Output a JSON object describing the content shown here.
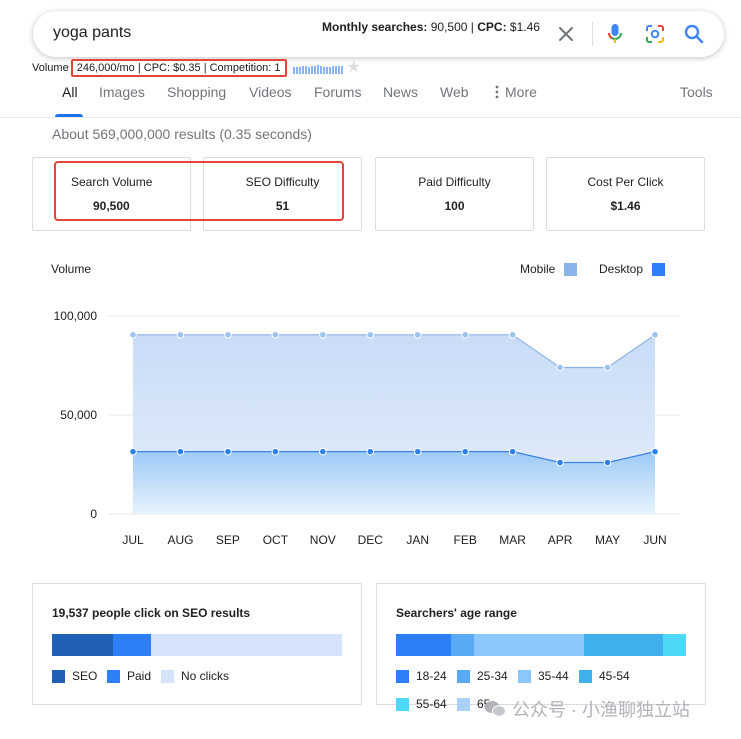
{
  "search": {
    "query": "yoga pants",
    "monthly_label": "Monthly searches:",
    "monthly_value": "90,500",
    "cpc_label": "CPC:",
    "cpc_value": "$1.46",
    "separator": "|"
  },
  "volume_strip": {
    "label": "Volume",
    "stats": "246,000/mo | CPC: $0.35 | Competition: 1",
    "trend_levels": [
      0.55,
      0.6,
      0.6,
      0.65,
      0.7,
      0.6,
      0.65,
      0.7,
      0.75,
      0.7,
      0.6,
      0.55,
      0.6,
      0.65,
      0.7,
      0.7,
      0.7
    ]
  },
  "tabs": [
    {
      "label": "All"
    },
    {
      "label": "Images"
    },
    {
      "label": "Shopping"
    },
    {
      "label": "Videos"
    },
    {
      "label": "Forums"
    },
    {
      "label": "News"
    },
    {
      "label": "Web"
    },
    {
      "label": "More"
    }
  ],
  "tools_label": "Tools",
  "results_info": "About 569,000,000 results (0.35 seconds)",
  "metrics": [
    {
      "label": "Search Volume",
      "value": "90,500"
    },
    {
      "label": "SEO Difficulty",
      "value": "51"
    },
    {
      "label": "Paid Difficulty",
      "value": "100"
    },
    {
      "label": "Cost Per Click",
      "value": "$1.46"
    }
  ],
  "volume_chart": {
    "title": "Volume",
    "legend": {
      "mobile": "Mobile",
      "desktop": "Desktop"
    },
    "colors": {
      "mobile": "#8ab4e8",
      "desktop": "#2d7ff9",
      "mobile_line": "#8ab4e8",
      "desktop_line": "#3b82e6"
    }
  },
  "chart_data": {
    "type": "area",
    "x": [
      "JUL",
      "AUG",
      "SEP",
      "OCT",
      "NOV",
      "DEC",
      "JAN",
      "FEB",
      "MAR",
      "APR",
      "MAY",
      "JUN"
    ],
    "series": [
      {
        "name": "Mobile",
        "values": [
          90500,
          90500,
          90500,
          90500,
          90500,
          90500,
          90500,
          90500,
          90500,
          74000,
          74000,
          90500
        ]
      },
      {
        "name": "Desktop",
        "values": [
          31500,
          31500,
          31500,
          31500,
          31500,
          31500,
          31500,
          31500,
          31500,
          26000,
          26000,
          31500
        ]
      }
    ],
    "ylim": [
      0,
      100000
    ],
    "yticks": [
      0,
      50000,
      100000
    ],
    "ytick_labels": [
      "0",
      "50,000",
      "100,000"
    ],
    "grid": true
  },
  "clicks": {
    "title": "19,537 people click on SEO results",
    "segments": [
      {
        "label": "SEO",
        "share": 0.21,
        "color": "#1f5fb5"
      },
      {
        "label": "Paid",
        "share": 0.13,
        "color": "#2d7ff9"
      },
      {
        "label": "No clicks",
        "share": 0.66,
        "color": "#d6e4fb"
      }
    ]
  },
  "ages": {
    "title": "Searchers' age range",
    "segments": [
      {
        "label": "18-24",
        "share": 0.19,
        "color": "#2d7ff9"
      },
      {
        "label": "25-34",
        "share": 0.08,
        "color": "#5aa9f5"
      },
      {
        "label": "35-44",
        "share": 0.38,
        "color": "#8cc7fb"
      },
      {
        "label": "45-54",
        "share": 0.27,
        "color": "#3fb0ec"
      },
      {
        "label": "55-64",
        "share": 0.08,
        "color": "#4dd8f7"
      },
      {
        "label": "65+",
        "share": 0.0,
        "color": "#a9d1fb"
      }
    ]
  },
  "watermark": "公众号 · 小渔聊独立站"
}
